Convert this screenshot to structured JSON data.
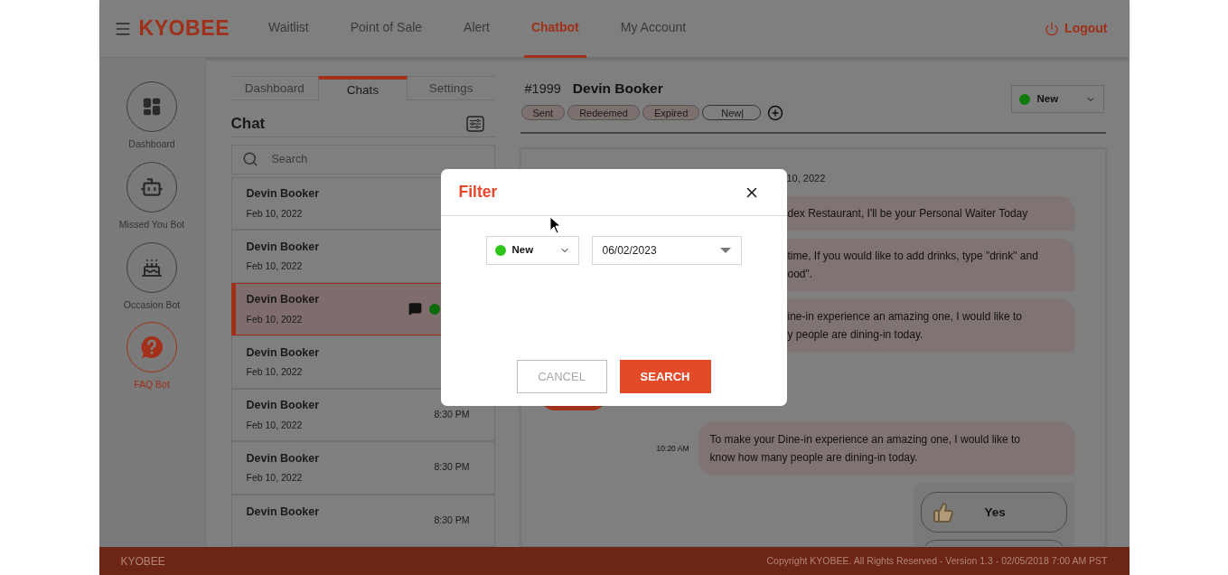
{
  "header": {
    "brand": "KYOBEE",
    "nav": [
      {
        "label": "Waitlist",
        "selected": false
      },
      {
        "label": "Point of Sale",
        "selected": false
      },
      {
        "label": "Alert",
        "selected": false
      },
      {
        "label": "Chatbot",
        "selected": true
      },
      {
        "label": "My Account",
        "selected": false
      }
    ],
    "logout": "Logout"
  },
  "sidebar": {
    "items": [
      {
        "label": "Dashboard",
        "kind": "dashboard",
        "selected": false
      },
      {
        "label": "Missed You Bot",
        "kind": "robot",
        "selected": false
      },
      {
        "label": "Occasion Bot",
        "kind": "cake",
        "selected": false
      },
      {
        "label": "FAQ Bot",
        "kind": "faq",
        "selected": true
      }
    ]
  },
  "chat_panel": {
    "tabs": [
      {
        "label": "Dashboard",
        "selected": false
      },
      {
        "label": "Chats",
        "selected": true
      },
      {
        "label": "Settings",
        "selected": false
      }
    ],
    "title": "Chat",
    "search": {
      "placeholder": "Search"
    },
    "chats": [
      {
        "name": "Devin Booker",
        "date": "Feb 10, 2022",
        "selected": false,
        "new_message": false
      },
      {
        "name": "Devin Booker",
        "date": "Feb 10, 2022",
        "selected": false,
        "new_message": false
      },
      {
        "name": "Devin Booker",
        "date": "Feb 10, 2022",
        "selected": true,
        "new_message": true
      },
      {
        "name": "Devin Booker",
        "date": "Feb 10, 2022",
        "selected": false,
        "new_message": false
      },
      {
        "name": "Devin Booker",
        "date": "Feb 10, 2022",
        "time": "8:30 PM",
        "selected": false,
        "new_message": false
      },
      {
        "name": "Devin Booker",
        "date": "Feb 10, 2022",
        "time": "8:30 PM",
        "selected": false,
        "new_message": false
      },
      {
        "name": "Devin Booker",
        "time": "8:30 PM",
        "selected": false,
        "new_message": false
      }
    ]
  },
  "conversation": {
    "number": "#1999",
    "name": "Devin Booker",
    "tags": [
      {
        "label": "Sent",
        "kind": "tag"
      },
      {
        "label": "Redeemed",
        "kind": "tag"
      },
      {
        "label": "Expired",
        "kind": "tag"
      },
      {
        "label": "New|",
        "kind": "input"
      }
    ],
    "status": "New",
    "date": "10, 2022",
    "messages": [
      {
        "kind": "covered",
        "lines": [
          "dex Restaurant, I'll be your Personal Waiter Today"
        ]
      },
      {
        "kind": "covered",
        "lines": [
          "time, If you would like to add drinks, type \"drink\" and",
          "ood\"."
        ]
      },
      {
        "kind": "covered",
        "lines": [
          "ine-in experience an amazing one, I would like to",
          "y people are dining-in today."
        ]
      },
      {
        "kind": "reply"
      },
      {
        "kind": "full",
        "time": "10:20 AM",
        "lines": [
          "To make your Dine-in experience an amazing one, I would like to",
          "know how many people are dining-in today."
        ]
      }
    ],
    "quick_replies": [
      "Yes"
    ]
  },
  "modal": {
    "title": "Filter",
    "status": "New",
    "date": "06/02/2023",
    "cancel": "CANCEL",
    "search": "SEARCH"
  },
  "footer": {
    "brand": "KYOBEE",
    "copyright": "Copyright KYOBEE. All Rights Reserved - Version 1.3 - 02/05/2018 7:00 AM PST"
  }
}
